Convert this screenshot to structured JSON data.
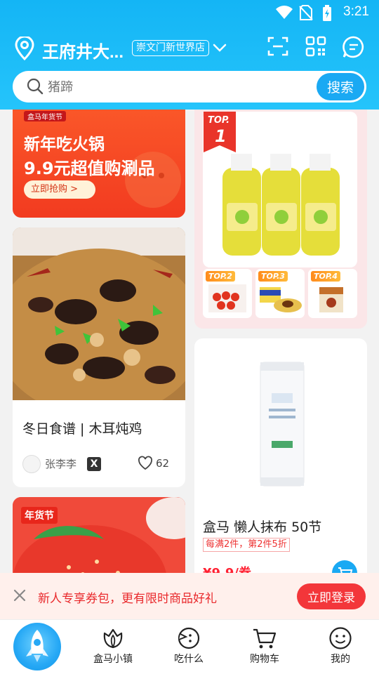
{
  "status_bar": {
    "time": "3:21",
    "icons": [
      "wifi-icon",
      "no-sim-icon",
      "battery-icon"
    ]
  },
  "header": {
    "location_name": "王府井大...",
    "store_badge": "崇文门新世界店",
    "icons": [
      "location-pin-icon",
      "chevron-down-icon",
      "scan-icon",
      "qr-code-icon",
      "message-icon"
    ]
  },
  "search": {
    "placeholder": "猪蹄",
    "button_label": "搜索"
  },
  "feed": {
    "promo": {
      "mini_tag": "盒马年货节",
      "title": "新年吃火锅",
      "subtitle": "9.9元超值购涮品",
      "button_label": "立即抢购 >"
    },
    "recipe": {
      "title": "冬日食谱 | 木耳炖鸡",
      "author": "张李李",
      "author_badge": "X",
      "likes": "62"
    },
    "strawberry": {
      "tag": "年货节"
    },
    "ranking": {
      "top1_label": "TOP.",
      "top1_num": "1",
      "tags": [
        "TOP.2",
        "TOP.3",
        "TOP.4"
      ]
    },
    "product": {
      "name": "盒马 懒人抹布 50节",
      "promo": "每满2件，第2件5折",
      "price": "¥9.9/卷"
    }
  },
  "coupon_bar": {
    "text": "新人专享券包，更有限时商品好礼",
    "button_label": "立即登录"
  },
  "bottom_nav": {
    "items": [
      {
        "label": "盒马小镇",
        "icon": "tulip-icon"
      },
      {
        "label": "吃什么",
        "icon": "eat-face-icon"
      },
      {
        "label": "购物车",
        "icon": "cart-icon"
      },
      {
        "label": "我的",
        "icon": "profile-smile-icon"
      }
    ]
  },
  "colors": {
    "brand_blue": "#1aa9f3",
    "promo_red": "#f3363a"
  }
}
